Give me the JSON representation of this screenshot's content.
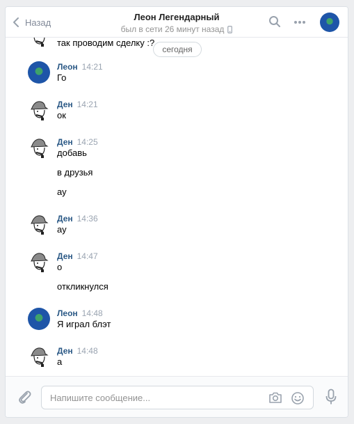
{
  "header": {
    "back_label": "Назад",
    "title": "Леон Легендарный",
    "status": "был в сети 26 минут назад"
  },
  "feed": {
    "partial_top_text": "так проводим сделку :?",
    "day_label": "сегодня",
    "messages": [
      {
        "author": "Леон",
        "time": "14:21",
        "avatar": "leon-avatar",
        "lines": [
          "Го"
        ]
      },
      {
        "author": "Ден",
        "time": "14:21",
        "avatar": "detective-avatar",
        "lines": [
          "ок"
        ]
      },
      {
        "author": "Ден",
        "time": "14:25",
        "avatar": "detective-avatar",
        "lines": [
          "добавь",
          "в друзья",
          "ау"
        ]
      },
      {
        "author": "Ден",
        "time": "14:36",
        "avatar": "detective-avatar",
        "lines": [
          "ау"
        ]
      },
      {
        "author": "Ден",
        "time": "14:47",
        "avatar": "detective-avatar",
        "lines": [
          "о",
          "откликнулся"
        ]
      },
      {
        "author": "Леон",
        "time": "14:48",
        "avatar": "leon-avatar",
        "lines": [
          "Я играл блэт"
        ]
      },
      {
        "author": "Ден",
        "time": "14:48",
        "avatar": "detective-avatar",
        "lines": [
          "а"
        ]
      }
    ]
  },
  "composer": {
    "placeholder": "Напишите сообщение...",
    "value": ""
  },
  "colors": {
    "author": "#2a5885",
    "time": "#9aa4b1",
    "background": "#edeef0"
  }
}
